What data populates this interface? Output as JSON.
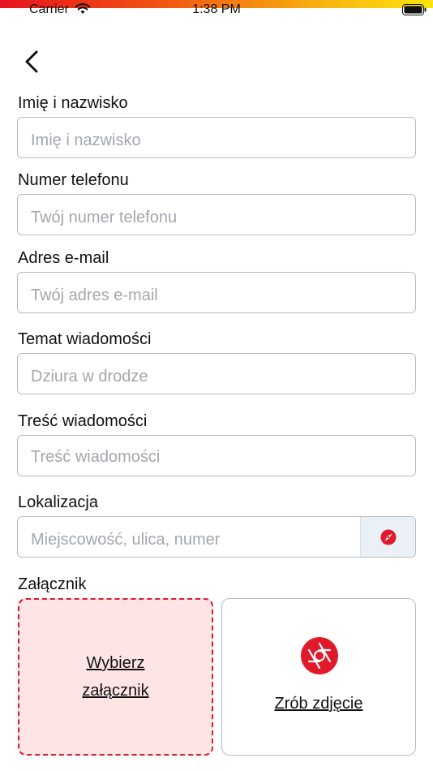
{
  "status_bar": {
    "carrier": "Carrier",
    "time": "1:38 PM",
    "icons": [
      "wifi-icon",
      "battery-icon"
    ]
  },
  "nav": {
    "back_icon": "chevron-left-icon"
  },
  "form": {
    "name": {
      "label": "Imię i nazwisko",
      "placeholder": "Imię i nazwisko",
      "value": ""
    },
    "phone": {
      "label": "Numer telefonu",
      "placeholder": "Twój numer telefonu",
      "value": ""
    },
    "email": {
      "label": "Adres e-mail",
      "placeholder": "Twój adres e-mail",
      "value": ""
    },
    "subject": {
      "label": "Temat wiadomości",
      "placeholder": "Dziura w drodze",
      "value": ""
    },
    "message": {
      "label": "Treść wiadomości",
      "placeholder": "Treść wiadomości",
      "value": ""
    },
    "location": {
      "label": "Lokalizacja",
      "placeholder": "Miejscowość, ulica, numer",
      "value": "",
      "icon": "compass-icon"
    }
  },
  "attachment": {
    "label": "Załącznik",
    "choose_label": "Wybierz załącznik",
    "photo_label": "Zrób zdjęcie",
    "photo_icon": "camera-shutter-icon"
  },
  "colors": {
    "accent": "#e11a2b",
    "dashed_area_bg": "#fde5e6",
    "compass_button_bg": "#eaf0f6",
    "field_border": "#b9bcc2",
    "placeholder": "#a3a7ad"
  }
}
